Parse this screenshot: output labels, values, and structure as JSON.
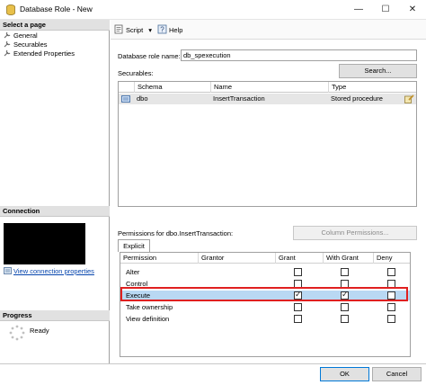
{
  "window": {
    "title": "Database Role - New",
    "minimize": "—",
    "maximize": "☐",
    "close": "✕"
  },
  "left_pane": {
    "select_page_header": "Select a page",
    "pages": [
      {
        "label": "General",
        "icon": "wrench-icon"
      },
      {
        "label": "Securables",
        "icon": "wrench-icon"
      },
      {
        "label": "Extended Properties",
        "icon": "wrench-icon"
      }
    ],
    "connection_header": "Connection",
    "view_connection_properties": "View connection properties",
    "progress_header": "Progress",
    "progress_status": "Ready"
  },
  "toolbar": {
    "script_label": "Script",
    "script_dropdown_icon": "▾",
    "help_label": "Help"
  },
  "form": {
    "role_name_label": "Database role name:",
    "role_name_value": "db_spexecution",
    "securables_label": "Securables:",
    "search_button": "Search..."
  },
  "securables_table": {
    "columns": [
      "Schema",
      "Name",
      "Type"
    ],
    "rows": [
      {
        "schema": "dbo",
        "name": "InsertTransaction",
        "type": "Stored procedure"
      }
    ]
  },
  "permissions": {
    "label": "Permissions for dbo.InsertTransaction:",
    "column_permissions_button": "Column Permissions...",
    "tab_label": "Explicit",
    "columns": [
      "Permission",
      "Grantor",
      "Grant",
      "With Grant",
      "Deny"
    ],
    "rows": [
      {
        "permission": "Alter",
        "grant": false,
        "with_grant": false,
        "deny": false,
        "selected": false
      },
      {
        "permission": "Control",
        "grant": false,
        "with_grant": false,
        "deny": false,
        "selected": false
      },
      {
        "permission": "Execute",
        "grant": true,
        "with_grant": true,
        "deny": false,
        "selected": true
      },
      {
        "permission": "Take ownership",
        "grant": false,
        "with_grant": false,
        "deny": false,
        "selected": false
      },
      {
        "permission": "View definition",
        "grant": false,
        "with_grant": false,
        "deny": false,
        "selected": false
      }
    ]
  },
  "footer": {
    "ok_button": "OK",
    "cancel_button": "Cancel"
  },
  "colors": {
    "selected_row": "#b9d8f3",
    "highlight_border": "#e02020",
    "link": "#0645ad"
  }
}
